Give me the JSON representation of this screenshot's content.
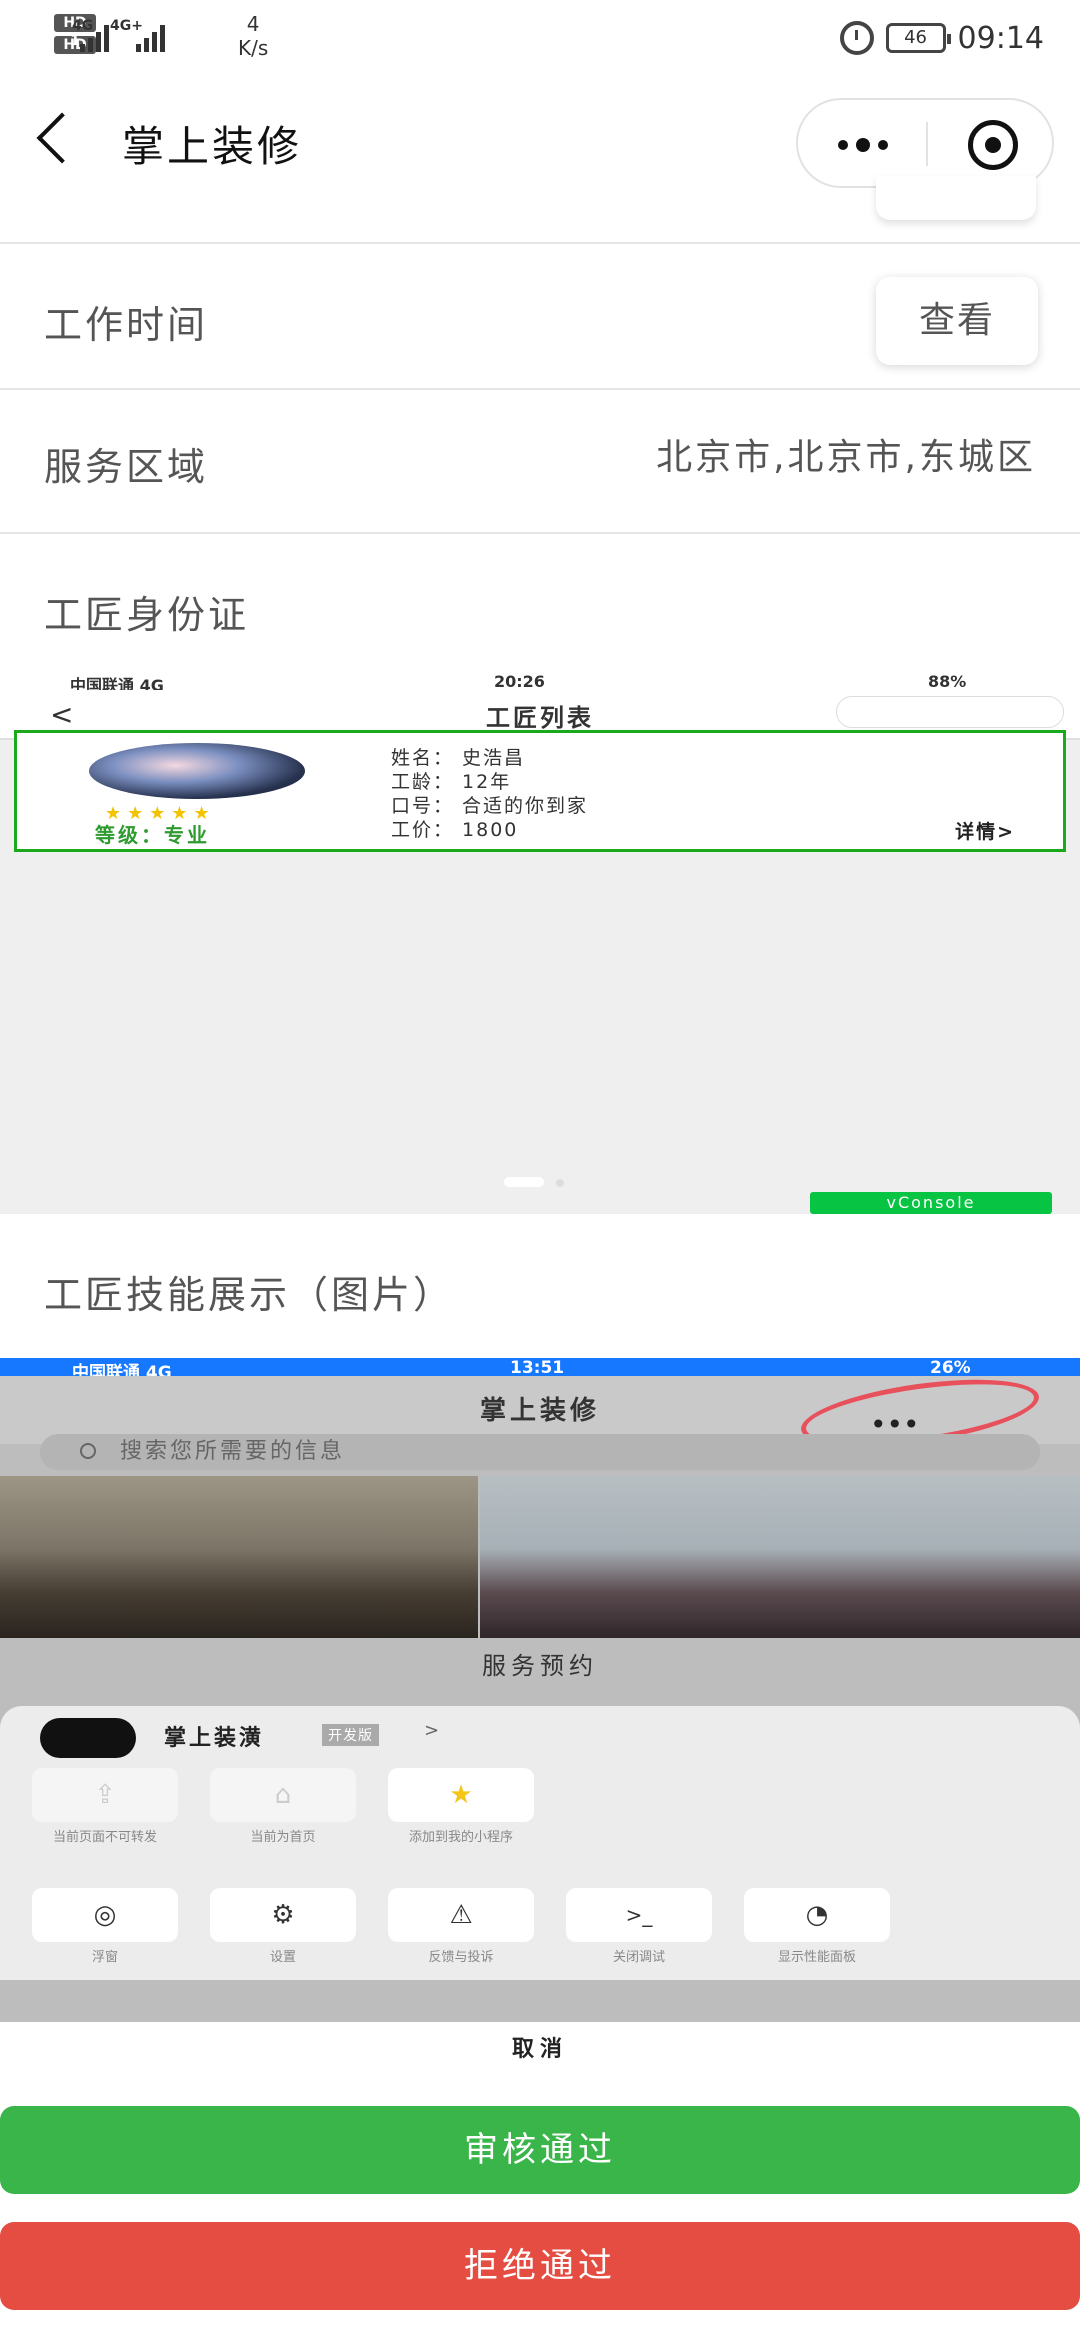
{
  "status_bar": {
    "hd1": "HD 1",
    "hd2": "HD 2",
    "net1": "4G",
    "net2": "4G+",
    "speed_value": "4",
    "speed_unit": "K/s",
    "battery": "46",
    "time": "09:14"
  },
  "nav": {
    "title": "掌上装修"
  },
  "rows": {
    "work_time_label": "工作时间",
    "view_button": "查看",
    "service_area_label": "服务区域",
    "service_area_value": "北京市,北京市,东城区",
    "id_card_label": "工匠身份证",
    "skill_label": "工匠技能展示（图片）"
  },
  "shot1": {
    "carrier": "中国联通 4G",
    "time": "20:26",
    "battery": "88%",
    "back": "<",
    "title": "工匠列表",
    "stars": "★★★★★",
    "level": "等级：专业",
    "name_line": "姓名：  史浩昌",
    "years_line": "工龄：  12年",
    "slogan_line": "口号：  合适的你到家",
    "price_line": "工价：  1800",
    "detail": "详情>",
    "vconsole": "vConsole"
  },
  "shot2": {
    "carrier": "中国联通 4G",
    "time": "13:51",
    "battery": "26%",
    "title": "掌上装修",
    "search_placeholder": "搜索您所需要的信息",
    "service_label": "服务预约",
    "miniprogram_name": "掌上装潢",
    "miniprogram_tag": "开发版",
    "miniprogram_arrow": ">",
    "options_row1": [
      {
        "icon": "share-icon",
        "label": "当前页面不可转发",
        "dim": true
      },
      {
        "icon": "home-icon",
        "label": "当前为首页",
        "dim": true
      },
      {
        "icon": "star-icon",
        "label": "添加到我的小程序",
        "dim": false
      }
    ],
    "options_row2": [
      {
        "icon": "float-icon",
        "label": "浮窗"
      },
      {
        "icon": "settings-icon",
        "label": "设置"
      },
      {
        "icon": "warning-icon",
        "label": "反馈与投诉"
      },
      {
        "icon": "terminal-icon",
        "label": "关闭调试"
      },
      {
        "icon": "gauge-icon",
        "label": "显示性能面板"
      }
    ],
    "cancel": "取消"
  },
  "actions": {
    "approve": "审核通过",
    "reject": "拒绝通过"
  },
  "colors": {
    "approve": "#39b54a",
    "reject": "#e54d42",
    "card_border": "#1aa91a",
    "status_blue": "#1677ff"
  }
}
